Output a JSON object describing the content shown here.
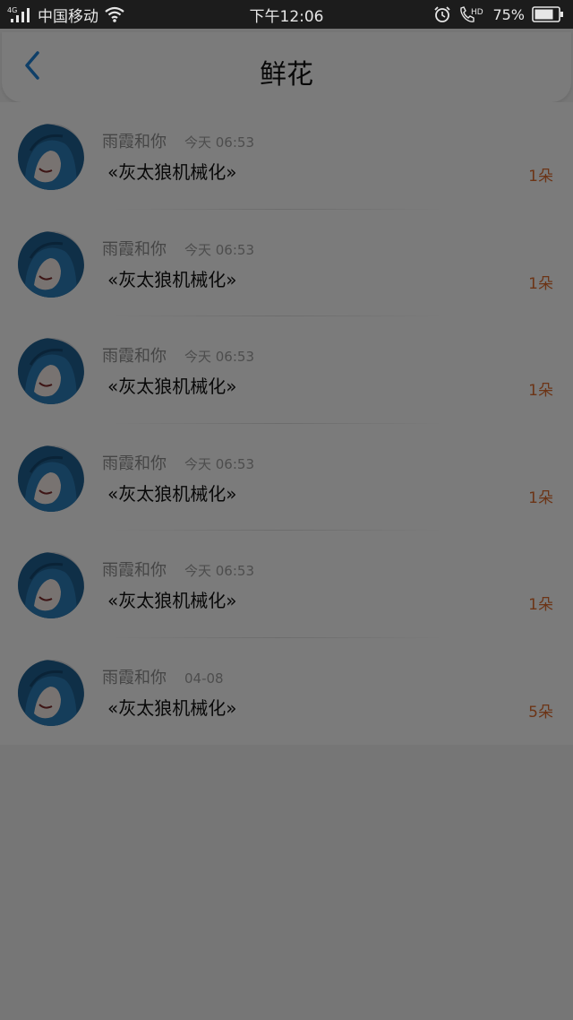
{
  "status_bar": {
    "network": "4G",
    "carrier": "中国移动",
    "time": "下午12:06",
    "hd": "HD",
    "battery": "75%"
  },
  "header": {
    "title": "鲜花"
  },
  "list": [
    {
      "user": "雨霞和你",
      "time": "今天 06:53",
      "gift": "«灰太狼机械化»",
      "count": "1朵"
    },
    {
      "user": "雨霞和你",
      "time": "今天 06:53",
      "gift": "«灰太狼机械化»",
      "count": "1朵"
    },
    {
      "user": "雨霞和你",
      "time": "今天 06:53",
      "gift": "«灰太狼机械化»",
      "count": "1朵"
    },
    {
      "user": "雨霞和你",
      "time": "今天 06:53",
      "gift": "«灰太狼机械化»",
      "count": "1朵"
    },
    {
      "user": "雨霞和你",
      "time": "今天 06:53",
      "gift": "«灰太狼机械化»",
      "count": "1朵"
    },
    {
      "user": "雨霞和你",
      "time": "04-08",
      "gift": "«灰太狼机械化»",
      "count": "5朵"
    }
  ],
  "icons": {
    "back": "chevron-left-icon",
    "signal": "signal-icon",
    "wifi": "wifi-icon",
    "alarm": "alarm-icon",
    "call": "call-icon",
    "battery": "battery-icon",
    "avatar": "anime-avatar"
  },
  "colors": {
    "accent": "#1e7fd0",
    "count": "#d9692c",
    "status_bar": "#1c1c1c",
    "dim_overlay": "rgba(0,0,0,0.5)"
  }
}
